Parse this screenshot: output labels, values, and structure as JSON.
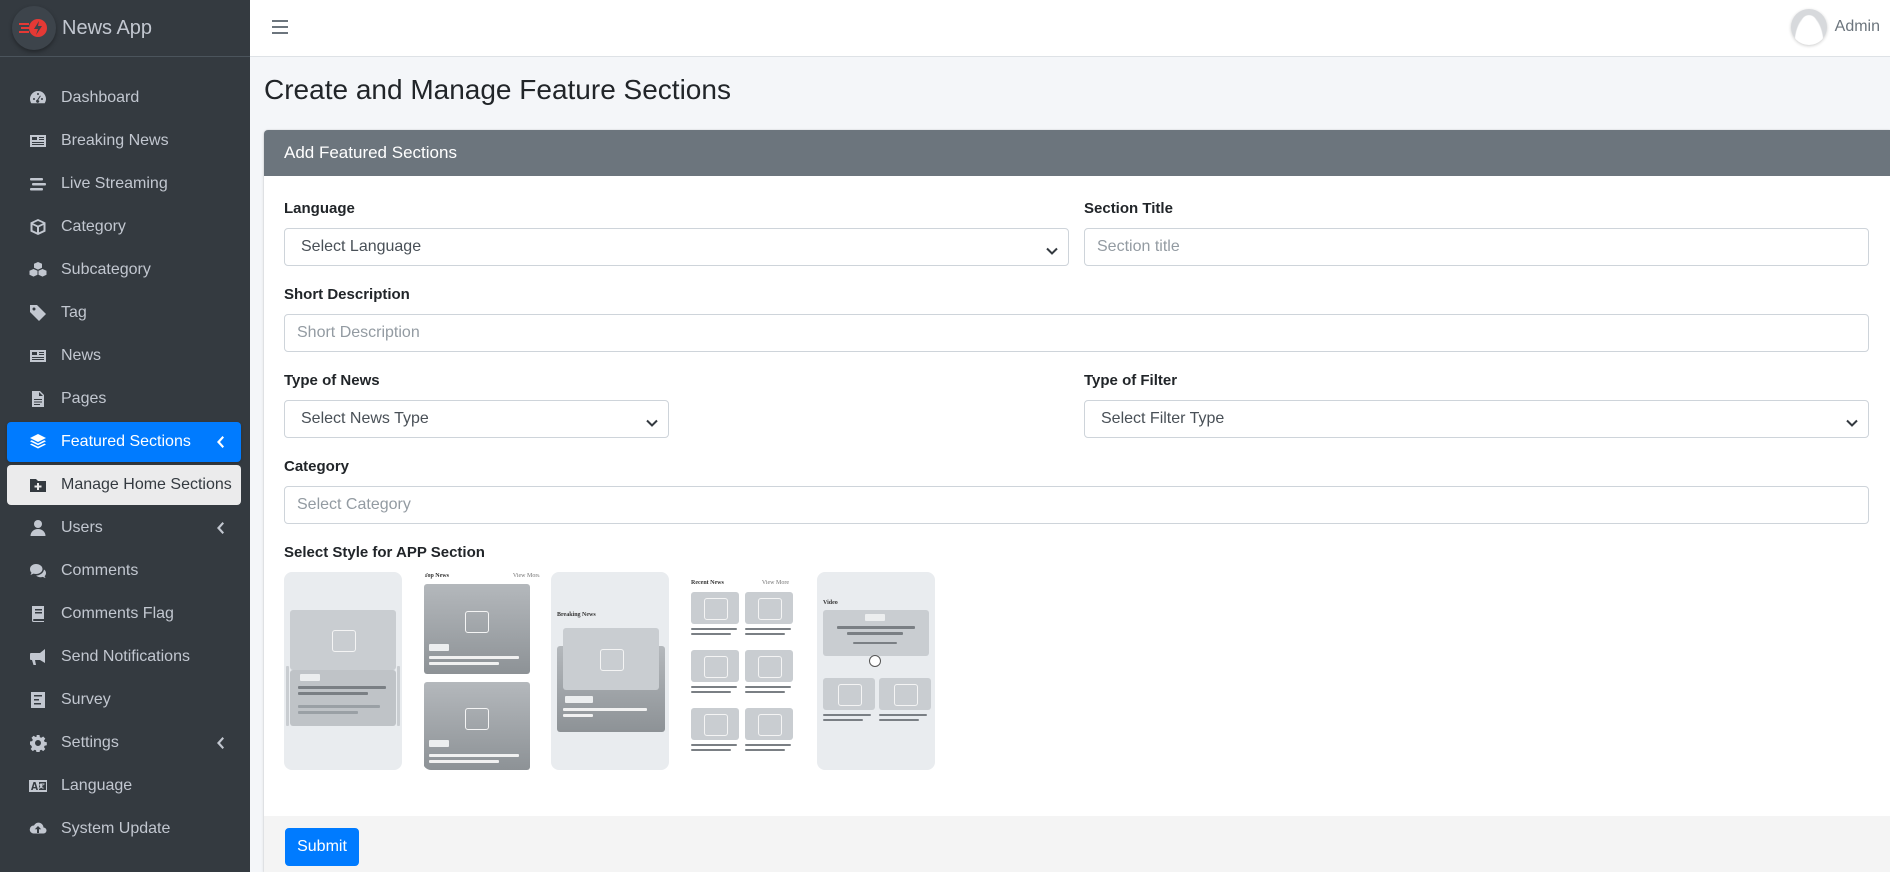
{
  "brand": {
    "name": "News App"
  },
  "topbar": {
    "user": "Admin"
  },
  "sidebar": {
    "items": [
      {
        "label": "Dashboard",
        "icon": "tachometer-icon"
      },
      {
        "label": "Breaking News",
        "icon": "newspaper-icon"
      },
      {
        "label": "Live Streaming",
        "icon": "stream-icon"
      },
      {
        "label": "Category",
        "icon": "cube-icon"
      },
      {
        "label": "Subcategory",
        "icon": "cubes-icon"
      },
      {
        "label": "Tag",
        "icon": "tag-icon"
      },
      {
        "label": "News",
        "icon": "newspaper-icon"
      },
      {
        "label": "Pages",
        "icon": "file-icon"
      },
      {
        "label": "Featured Sections",
        "icon": "layer-group-icon"
      },
      {
        "label": "Manage Home Sections",
        "icon": "folder-plus-icon"
      },
      {
        "label": "Users",
        "icon": "user-icon"
      },
      {
        "label": "Comments",
        "icon": "comments-icon"
      },
      {
        "label": "Comments Flag",
        "icon": "book-icon"
      },
      {
        "label": "Send Notifications",
        "icon": "bullhorn-icon"
      },
      {
        "label": "Survey",
        "icon": "poll-icon"
      },
      {
        "label": "Settings",
        "icon": "gear-icon"
      },
      {
        "label": "Language",
        "icon": "language-icon"
      },
      {
        "label": "System Update",
        "icon": "cloud-upload-icon"
      }
    ]
  },
  "page": {
    "title": "Create and Manage Feature Sections"
  },
  "form": {
    "header": "Add Featured Sections",
    "language_label": "Language",
    "language_value": "Select Language",
    "section_title_label": "Section Title",
    "section_title_placeholder": "Section title",
    "short_desc_label": "Short Description",
    "short_desc_placeholder": "Short Description",
    "type_news_label": "Type of News",
    "type_news_value": "Select News Type",
    "type_filter_label": "Type of Filter",
    "type_filter_value": "Select Filter Type",
    "category_label": "Category",
    "category_placeholder": "Select Category",
    "style_label": "Select Style for APP Section",
    "style_thumbs": {
      "t2_title": "Top News",
      "t2_view": "View More",
      "t3_title": "Breaking News",
      "t4_title": "Recent News",
      "t4_view": "View More",
      "t5_title": "Video"
    },
    "submit": "Submit"
  },
  "colors": {
    "sidebar": "#343a40",
    "accent": "#007bff",
    "card_header": "#6c757d"
  }
}
